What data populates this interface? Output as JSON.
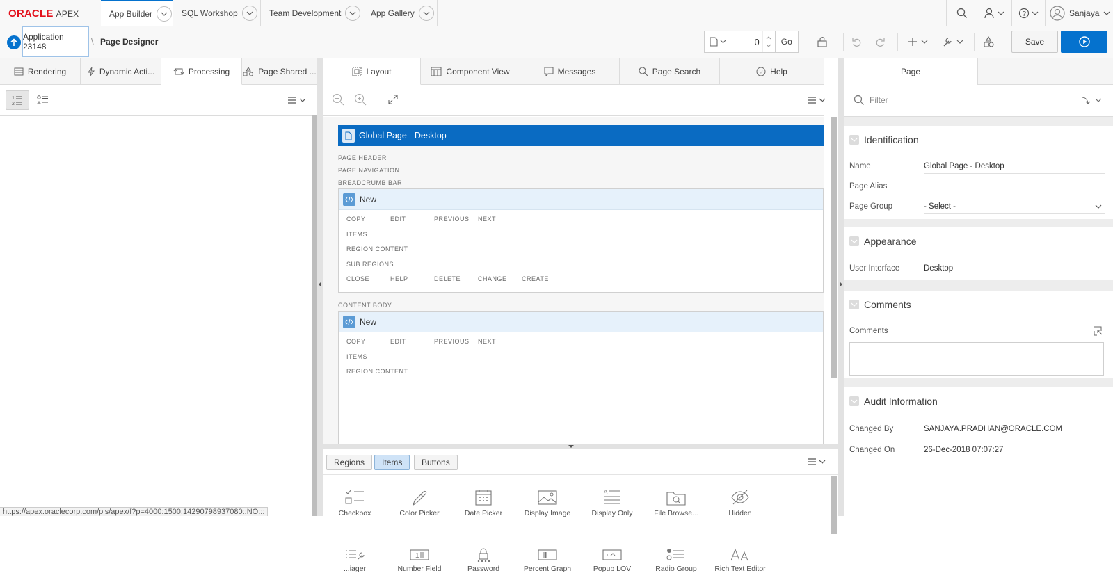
{
  "nav": {
    "logo_oracle": "ORACLE",
    "logo_apex": "APEX",
    "tabs": [
      "App Builder",
      "SQL Workshop",
      "Team Development",
      "App Gallery"
    ],
    "user": "Sanjaya"
  },
  "toolbar": {
    "breadcrumb_app": "Application 23148",
    "breadcrumb_sep": "\\",
    "breadcrumb_page": "Page Designer",
    "page_number": "0",
    "go_label": "Go",
    "save_label": "Save"
  },
  "left": {
    "tabs": [
      "Rendering",
      "Dynamic Acti...",
      "Processing",
      "Page Shared ..."
    ],
    "active_tab": "Processing"
  },
  "center": {
    "tabs": [
      "Layout",
      "Component View",
      "Messages",
      "Page Search",
      "Help"
    ],
    "page_title": "Global Page - Desktop",
    "labels": {
      "page_header": "PAGE HEADER",
      "page_navigation": "PAGE NAVIGATION",
      "breadcrumb_bar": "BREADCRUMB BAR",
      "content_body": "CONTENT BODY"
    },
    "region1": {
      "title": "New",
      "positions": {
        "copy": "COPY",
        "edit": "EDIT",
        "previous": "PREVIOUS",
        "next": "NEXT",
        "items": "ITEMS",
        "region_content": "REGION CONTENT",
        "sub_regions": "SUB REGIONS",
        "close": "CLOSE",
        "help": "HELP",
        "delete": "DELETE",
        "change": "CHANGE",
        "create": "CREATE"
      }
    },
    "region2": {
      "title": "New",
      "positions": {
        "copy": "COPY",
        "edit": "EDIT",
        "previous": "PREVIOUS",
        "next": "NEXT",
        "items": "ITEMS",
        "region_content": "REGION CONTENT"
      }
    },
    "gallery_tabs": [
      "Regions",
      "Items",
      "Buttons"
    ],
    "gallery_selected": "Items",
    "gallery_row1": [
      "Checkbox",
      "Color Picker",
      "Date Picker",
      "Display Image",
      "Display Only",
      "File Browse...",
      "Hidden"
    ],
    "gallery_row2": [
      "...iager",
      "Number Field",
      "Password",
      "Percent Graph",
      "Popup LOV",
      "Radio Group",
      "Rich Text Editor"
    ]
  },
  "right": {
    "tab": "Page",
    "filter_placeholder": "Filter",
    "identification": {
      "title": "Identification",
      "name_label": "Name",
      "name_value": "Global Page - Desktop",
      "alias_label": "Page Alias",
      "alias_value": "",
      "group_label": "Page Group",
      "group_value": "- Select -"
    },
    "appearance": {
      "title": "Appearance",
      "ui_label": "User Interface",
      "ui_value": "Desktop"
    },
    "comments": {
      "title": "Comments",
      "comments_label": "Comments"
    },
    "audit": {
      "title": "Audit Information",
      "changed_by_label": "Changed By",
      "changed_by_value": "SANJAYA.PRADHAN@ORACLE.COM",
      "changed_on_label": "Changed On",
      "changed_on_value": "26-Dec-2018 07:07:27"
    }
  },
  "status_url": "https://apex.oraclecorp.com/pls/apex/f?p=4000:1500:14290798937080::NO:::",
  "colors": {
    "accent": "#0572ce",
    "oracle_red": "#e3101b",
    "region_header": "#e6f1fb",
    "selected_button": "#cfe3f7"
  }
}
